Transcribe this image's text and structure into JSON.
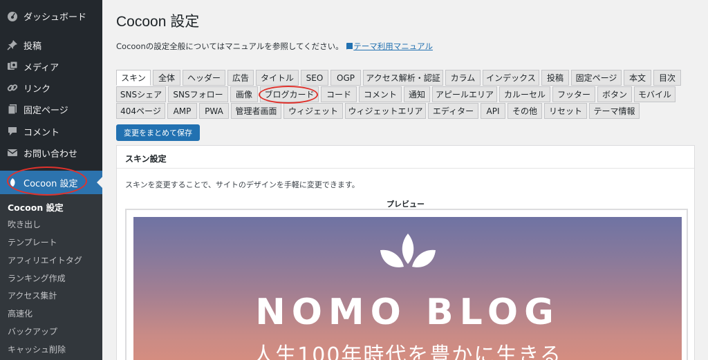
{
  "sidebar": {
    "items": [
      {
        "label": "ダッシュボード",
        "icon": "dashboard-icon"
      },
      {
        "label": "投稿",
        "icon": "pin-icon"
      },
      {
        "label": "メディア",
        "icon": "media-icon"
      },
      {
        "label": "リンク",
        "icon": "link-icon"
      },
      {
        "label": "固定ページ",
        "icon": "page-icon"
      },
      {
        "label": "コメント",
        "icon": "comment-icon"
      },
      {
        "label": "お問い合わせ",
        "icon": "mail-icon"
      },
      {
        "label": "Cocoon 設定",
        "icon": "cocoon-icon"
      }
    ],
    "submenu": [
      "Cocoon 設定",
      "吹き出し",
      "テンプレート",
      "アフィリエイトタグ",
      "ランキング作成",
      "アクセス集計",
      "高速化",
      "バックアップ",
      "キャッシュ削除"
    ]
  },
  "header": {
    "title": "Cocoon 設定",
    "intro": "Cocoonの設定全般についてはマニュアルを参照してください。",
    "manual_link": "テーマ利用マニュアル"
  },
  "tabs": {
    "row1": [
      "スキン",
      "全体",
      "ヘッダー",
      "広告",
      "タイトル",
      "SEO",
      "OGP",
      "アクセス解析・認証",
      "カラム",
      "インデックス",
      "投稿",
      "固定ページ",
      "本文",
      "目次"
    ],
    "row2": [
      "SNSシェア",
      "SNSフォロー",
      "画像",
      "ブログカード",
      "コード",
      "コメント",
      "通知",
      "アピールエリア",
      "カルーセル",
      "フッター",
      "ボタン",
      "モバイル"
    ],
    "row3": [
      "404ページ",
      "AMP",
      "PWA",
      "管理者画面",
      "ウィジェット",
      "ウィジェットエリア",
      "エディター",
      "API",
      "その他",
      "リセット",
      "テーマ情報"
    ]
  },
  "save_button": "変更をまとめて保存",
  "panel": {
    "title": "スキン設定",
    "description": "スキンを変更することで、サイトのデザインを手軽に変更できます。",
    "preview_label": "プレビュー",
    "blog_title": "NOMO BLOG",
    "tagline": "人生100年時代を豊かに生きる"
  },
  "colors": {
    "sidebar_bg": "#23282d",
    "accent": "#2271b1",
    "annotation_red": "#e0322c"
  }
}
